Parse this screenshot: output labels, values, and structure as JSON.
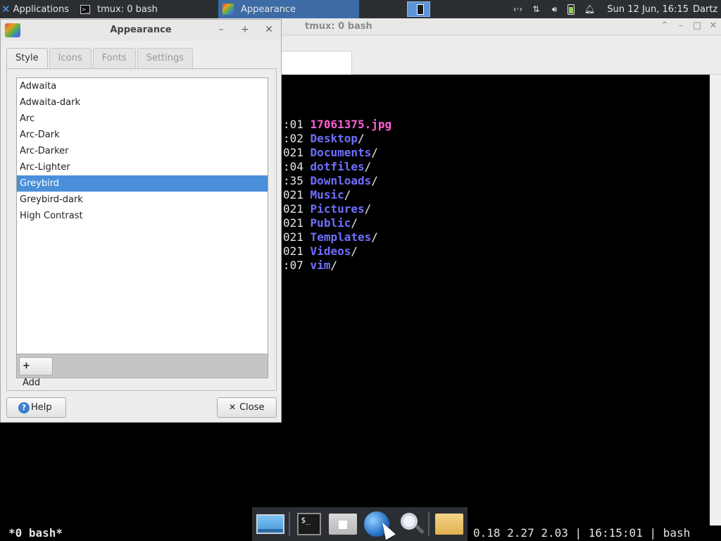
{
  "top_panel": {
    "applications_label": "Applications",
    "tasks": [
      {
        "label": "tmux: 0 bash",
        "icon": "terminal-icon"
      },
      {
        "label": "Appearance",
        "icon": "appearance-icon",
        "active": true
      }
    ],
    "clock": "Sun 12 Jun, 16:15",
    "user": "Dartz"
  },
  "terminal": {
    "title": "tmux: 0 bash",
    "listing": [
      {
        "time": ":01",
        "name": "17061375.jpg",
        "kind": "image",
        "slash": ""
      },
      {
        "time": ":02",
        "name": "Desktop",
        "kind": "dir",
        "slash": "/"
      },
      {
        "time": "021",
        "name": "Documents",
        "kind": "dir",
        "slash": "/"
      },
      {
        "time": ":04",
        "name": "dotfiles",
        "kind": "dir",
        "slash": "/"
      },
      {
        "time": ":35",
        "name": "Downloads",
        "kind": "dir",
        "slash": "/"
      },
      {
        "time": "021",
        "name": "Music",
        "kind": "dir",
        "slash": "/"
      },
      {
        "time": "021",
        "name": "Pictures",
        "kind": "dir",
        "slash": "/"
      },
      {
        "time": "021",
        "name": "Public",
        "kind": "dir",
        "slash": "/"
      },
      {
        "time": "021",
        "name": "Templates",
        "kind": "dir",
        "slash": "/"
      },
      {
        "time": "021",
        "name": "Videos",
        "kind": "dir",
        "slash": "/"
      },
      {
        "time": ":07",
        "name": "vim",
        "kind": "dir",
        "slash": "/"
      }
    ],
    "colors": {
      "dir": "#6f6fff",
      "image": "#ff5fd7"
    }
  },
  "tmux_status": {
    "window": "*0 bash*",
    "right": "0.18 2.27 2.03 | 16:15:01 | bash"
  },
  "appearance_dialog": {
    "title": "Appearance",
    "tabs": [
      "Style",
      "Icons",
      "Fonts",
      "Settings"
    ],
    "active_tab": "Style",
    "themes": [
      "Adwaita",
      "Adwaita-dark",
      "Arc",
      "Arc-Dark",
      "Arc-Darker",
      "Arc-Lighter",
      "Greybird",
      "Greybird-dark",
      "High Contrast"
    ],
    "selected_theme": "Greybird",
    "add_label": "Add",
    "help_label": "Help",
    "close_label": "Close",
    "selection_color": "#4a8fd9"
  },
  "dock": {
    "items": [
      "desktop-icon",
      "terminal-icon",
      "home-folder-icon",
      "web-browser-icon",
      "search-icon",
      "file-manager-icon"
    ]
  }
}
